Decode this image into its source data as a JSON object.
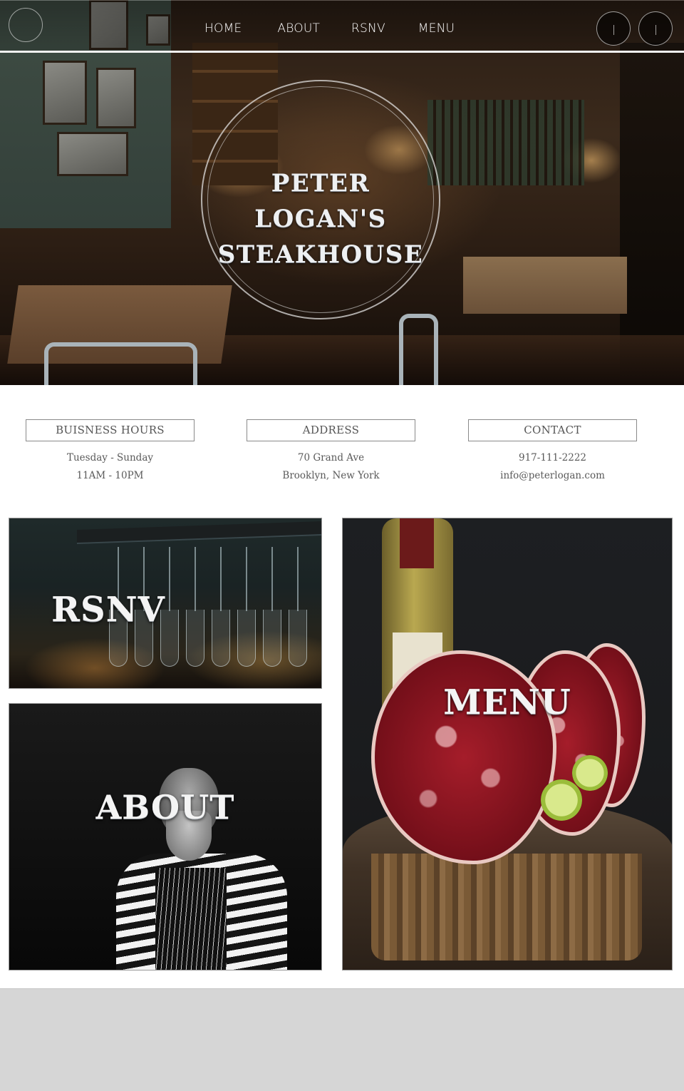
{
  "nav": {
    "links": [
      "HOME",
      "ABOUT",
      "RSNV",
      "MENU"
    ],
    "social_icons": [
      "social-icon-1",
      "social-icon-2"
    ]
  },
  "hero": {
    "title_line1": "PETER LOGAN'S",
    "title_line2": "STEAKHOUSE"
  },
  "info": {
    "hours": {
      "heading": "BUISNESS HOURS",
      "line1": "Tuesday - Sunday",
      "line2": "11AM - 10PM"
    },
    "address": {
      "heading": "ADDRESS",
      "line1": "70 Grand Ave",
      "line2": "Brooklyn, New York"
    },
    "contact": {
      "heading": "CONTACT",
      "line1": "917-111-2222",
      "line2": "info@peterlogan.com"
    }
  },
  "tiles": {
    "rsnv": "RSNV",
    "about": "ABOUT",
    "menu": "MENU"
  },
  "colors": {
    "nav_text": "#ffffff",
    "info_text": "#5a5a5a",
    "footer_bg": "#d6d6d6"
  }
}
